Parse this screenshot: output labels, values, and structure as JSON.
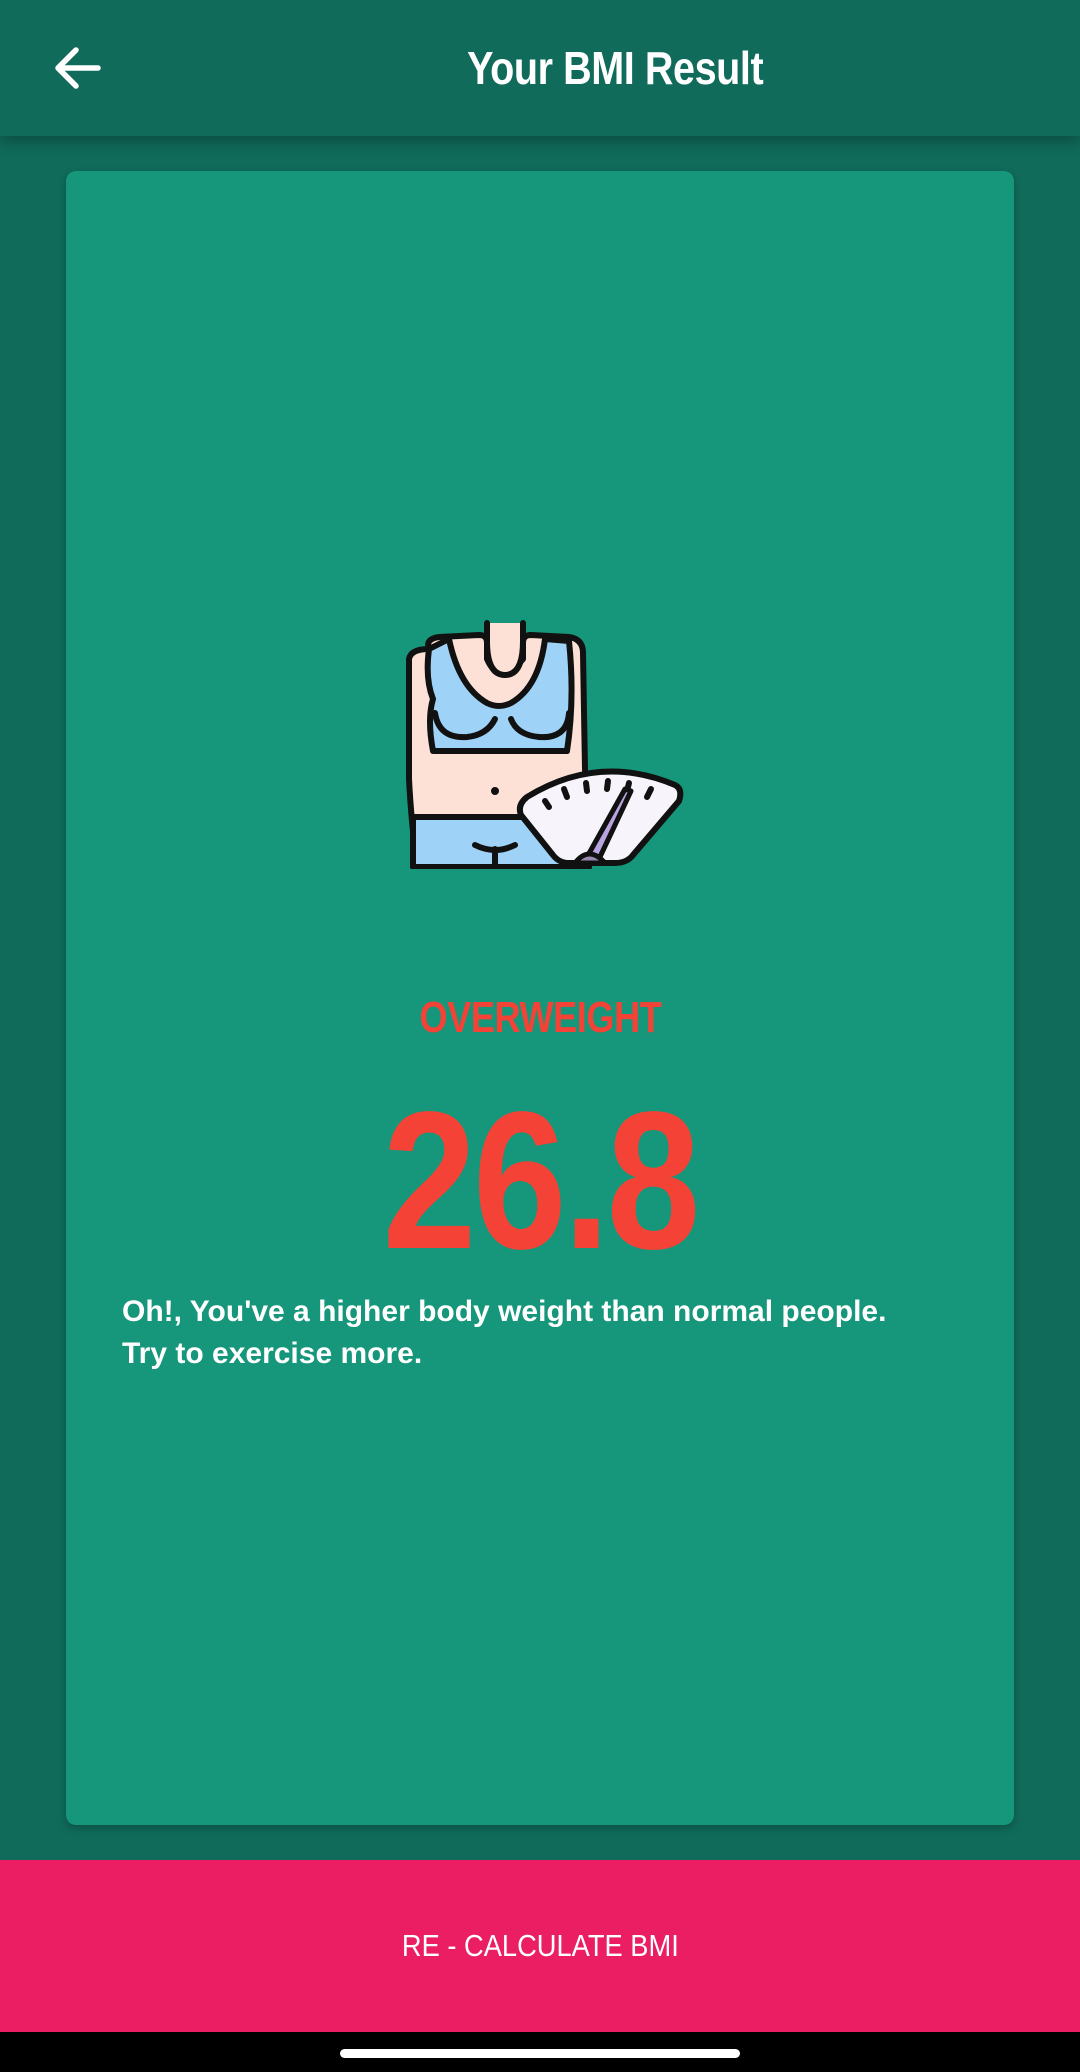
{
  "app_bar": {
    "title": "Your BMI Result",
    "back_icon": "arrow-left-icon"
  },
  "result": {
    "illustration": "body-weight-scale-illustration",
    "category": "OVERWEIGHT",
    "bmi_value": "26.8",
    "message": "Oh!, You've a higher body weight than normal people. Try to exercise more."
  },
  "action": {
    "recalculate_label": "RE - CALCULATE BMI"
  },
  "colors": {
    "background": "#106b5a",
    "card": "#16967a",
    "category": "#f44336",
    "button": "#eb1e63"
  }
}
